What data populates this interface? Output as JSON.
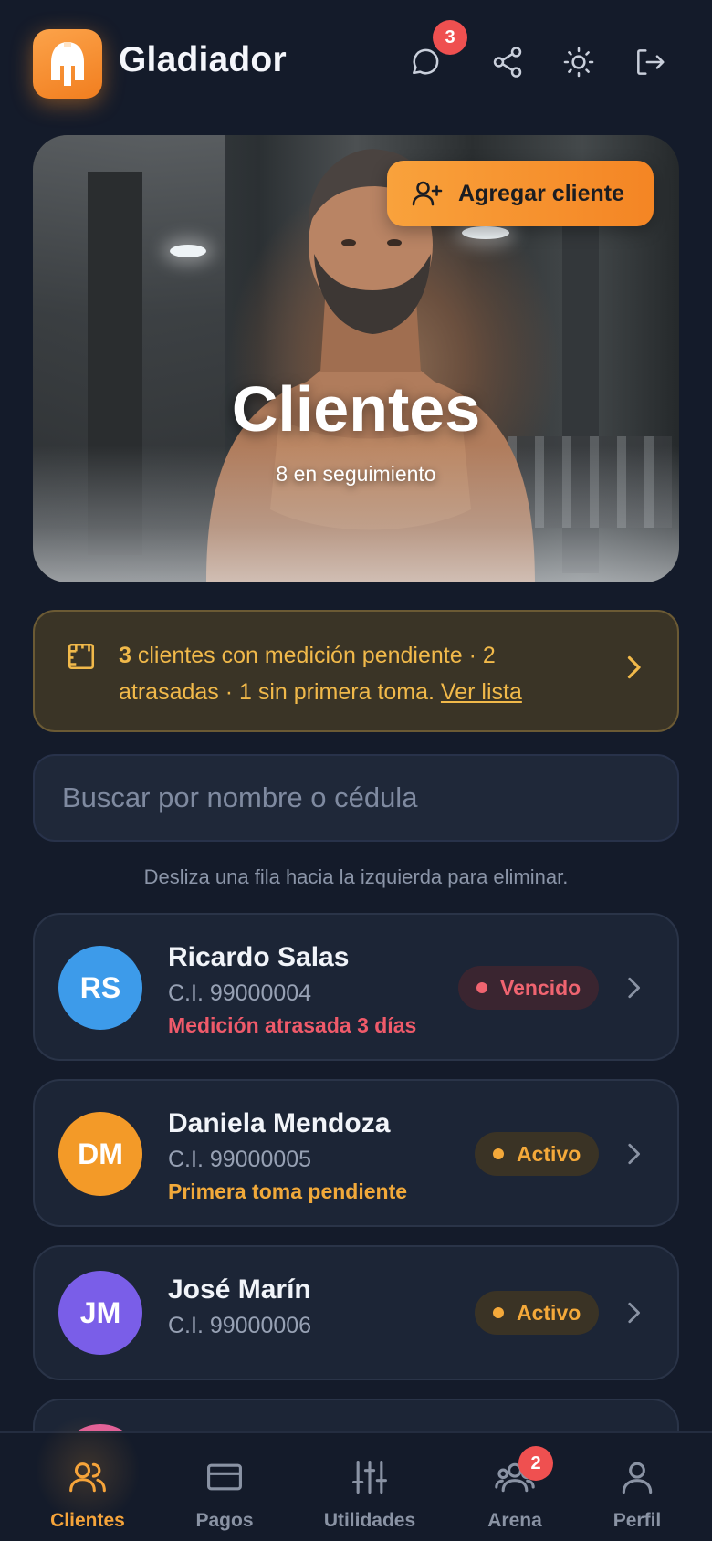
{
  "header": {
    "app_title": "Gladiador",
    "notifications_count": "3",
    "icons": [
      "chat-icon",
      "share-icon",
      "sun-icon",
      "logout-icon"
    ]
  },
  "hero": {
    "title": "Clientes",
    "subtitle": "8 en seguimiento",
    "add_button_label": "Agregar cliente"
  },
  "alert": {
    "count": "3",
    "text": " clientes con medición pendiente · 2 atrasadas · 1 sin primera toma. ",
    "link_label": "Ver lista"
  },
  "search": {
    "placeholder": "Buscar por nombre o cédula"
  },
  "hint": "Desliza una fila hacia la izquierda para eliminar.",
  "clients": [
    {
      "initials": "RS",
      "name": "Ricardo Salas",
      "id": "C.I. 99000004",
      "note": "Medición atrasada 3 días",
      "status": "Vencido",
      "avatar_color": "#3d9bea",
      "note_color": "#ef5a6a",
      "status_color": "#ef6470"
    },
    {
      "initials": "DM",
      "name": "Daniela Mendoza",
      "id": "C.I. 99000005",
      "note": "Primera toma pendiente",
      "status": "Activo",
      "avatar_color": "#f39a28",
      "note_color": "#f1a93a",
      "status_color": "#f4a93a"
    },
    {
      "initials": "JM",
      "name": "José Marín",
      "id": "C.I. 99000006",
      "note": "",
      "status": "Activo",
      "avatar_color": "#7a5ee8",
      "note_color": "#f1a93a",
      "status_color": "#f4a93a"
    }
  ],
  "nav": {
    "items": [
      {
        "label": "Clientes",
        "icon": "users-icon",
        "active": true
      },
      {
        "label": "Pagos",
        "icon": "card-icon",
        "active": false
      },
      {
        "label": "Utilidades",
        "icon": "sliders-icon",
        "active": false
      },
      {
        "label": "Arena",
        "icon": "group-icon",
        "active": false
      },
      {
        "label": "Perfil",
        "icon": "user-icon",
        "active": false
      }
    ],
    "arena_badge": "2"
  },
  "colors": {
    "background": "#141b2a",
    "accent": "#f6a43a",
    "danger": "#ef5050"
  }
}
